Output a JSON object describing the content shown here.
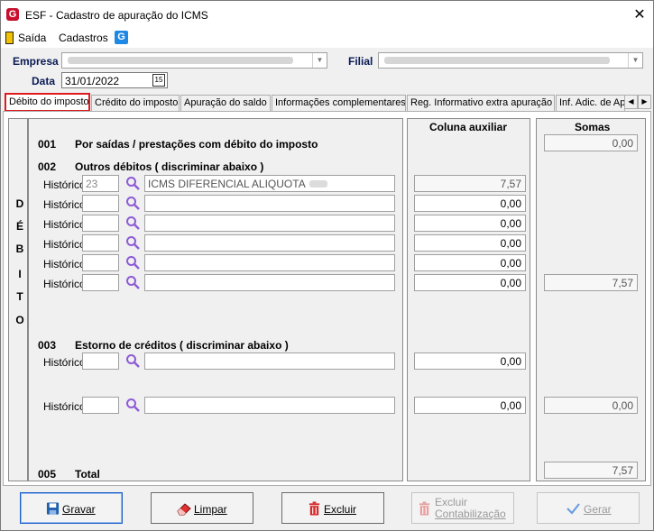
{
  "window": {
    "title": "ESF - Cadastro de apuração do ICMS",
    "close_symbol": "✕"
  },
  "menu": {
    "exit_label": "Saída",
    "registrations_label": "Cadastros"
  },
  "form": {
    "empresa_label": "Empresa",
    "filial_label": "Filial",
    "data_label": "Data",
    "data_value": "31/01/2022"
  },
  "tabs": [
    "Débito do imposto",
    "Crédito do imposto",
    "Apuração do saldo",
    "Informações complementares",
    "Reg. Informativo extra apuração",
    "Inf. Adic. de Ap"
  ],
  "panel": {
    "vertical_letters": [
      "D",
      "É",
      "B",
      "I",
      "T",
      "O"
    ],
    "col_aux_header": "Coluna auxiliar",
    "col_sums_header": "Somas",
    "s001": {
      "code": "001",
      "label": "Por saídas / prestações com débito do imposto",
      "sum": "0,00"
    },
    "s002": {
      "code": "002",
      "label": "Outros débitos ( discriminar abaixo )",
      "sum": "7,57"
    },
    "historico_label": "Histórico",
    "s002_rows": [
      {
        "code": "23",
        "desc": "ICMS DIFERENCIAL ALIQUOTA",
        "aux": "7,57"
      },
      {
        "code": "",
        "desc": "",
        "aux": "0,00"
      },
      {
        "code": "",
        "desc": "",
        "aux": "0,00"
      },
      {
        "code": "",
        "desc": "",
        "aux": "0,00"
      },
      {
        "code": "",
        "desc": "",
        "aux": "0,00"
      },
      {
        "code": "",
        "desc": "",
        "aux": "0,00"
      }
    ],
    "s003": {
      "code": "003",
      "label": "Estorno de créditos ( discriminar abaixo )"
    },
    "s003_rows": [
      {
        "code": "",
        "desc": "",
        "aux": "0,00"
      },
      {
        "code": "",
        "desc": "",
        "aux": "0,00",
        "sum": "0,00"
      }
    ],
    "s005": {
      "code": "005",
      "label": "Total",
      "sum": "7,57"
    }
  },
  "buttons": {
    "save": "Gravar",
    "clear": "Limpar",
    "delete": "Excluir",
    "delete_acc_line1": "Excluir",
    "delete_acc_line2": "Contabilização",
    "generate": "Gerar"
  },
  "icons": {
    "save": "floppy-icon",
    "clear": "eraser-icon",
    "delete": "trash-icon",
    "generate": "checkmark-icon",
    "search": "magnifier-icon"
  },
  "colors": {
    "tab_highlight": "#e0191f",
    "magnifier": "#8e5bd6",
    "label_navy": "#0a1a55",
    "brand_red": "#c8102e",
    "brand_blue": "#1e88e5"
  }
}
